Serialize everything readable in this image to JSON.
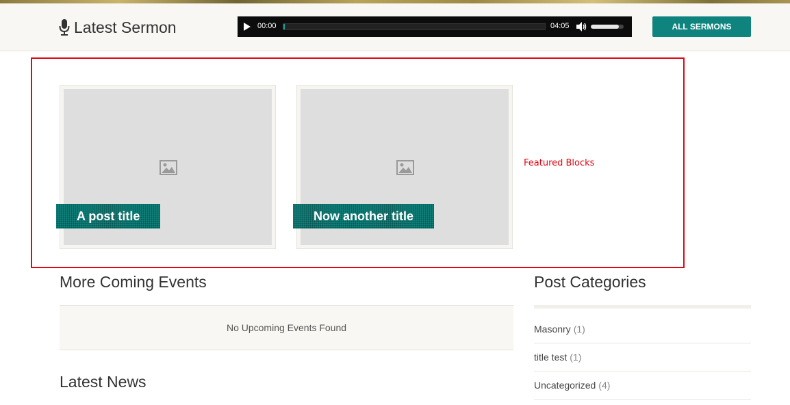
{
  "sermon": {
    "title": "Latest Sermon",
    "player": {
      "current_time": "00:00",
      "duration": "04:05",
      "progress": 0.005,
      "volume": 0.85,
      "accent_color": "#19a39c"
    },
    "all_button": "ALL SERMONS"
  },
  "featured": {
    "cards": [
      {
        "title": "A post title"
      },
      {
        "title": "Now another title"
      }
    ],
    "annotation": "Featured Blocks",
    "annotation_color": "#e30613"
  },
  "events": {
    "heading": "More Coming Events",
    "empty_message": "No Upcoming Events Found"
  },
  "news": {
    "heading": "Latest News"
  },
  "categories": {
    "heading": "Post Categories",
    "items": [
      {
        "name": "Masonry",
        "count": "(1)"
      },
      {
        "name": "title test",
        "count": "(1)"
      },
      {
        "name": "Uncategorized",
        "count": "(4)"
      }
    ]
  },
  "colors": {
    "brand_teal": "#0f837e"
  }
}
